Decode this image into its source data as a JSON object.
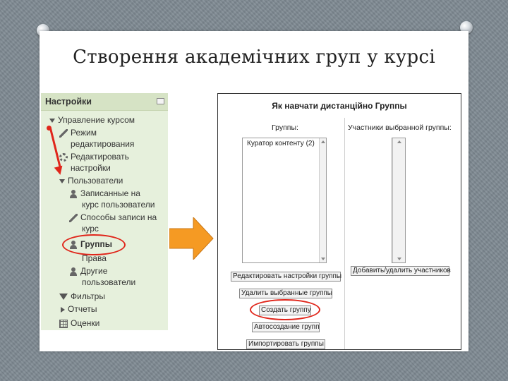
{
  "slide": {
    "title": "Створення академічних груп у курсі"
  },
  "settings_panel": {
    "header": "Настройки",
    "items": [
      {
        "label": "Управление курсом"
      },
      {
        "label": "Режим"
      },
      {
        "label": "редактирования"
      },
      {
        "label": "Редактировать"
      },
      {
        "label": "настройки"
      },
      {
        "label": "Пользователи"
      },
      {
        "label": "Записанные на"
      },
      {
        "label": "курс пользователи"
      },
      {
        "label": "Способы записи на"
      },
      {
        "label": "курс"
      },
      {
        "label": "Группы"
      },
      {
        "label": "Права"
      },
      {
        "label": "Другие"
      },
      {
        "label": "пользователи"
      },
      {
        "label": "Фильтры"
      },
      {
        "label": "Отчеты"
      },
      {
        "label": "Оценки"
      }
    ]
  },
  "groups_panel": {
    "title": "Як навчати дистанційно Группы",
    "groups_label": "Группы:",
    "members_label": "Участники выбранной группы:",
    "groups_list": [
      "Куратор контенту (2)"
    ],
    "buttons": {
      "edit_group_settings": "Редактировать настройки группы",
      "delete_selected_groups": "Удалить выбранные группы",
      "create_group": "Создать группу",
      "auto_create_groups": "Автосоздание групп",
      "import_groups": "Импортировать группы",
      "add_remove_members": "Добавить/удалить участников"
    }
  },
  "colors": {
    "highlight": "#e0261b",
    "arrow": "#f59a23",
    "panel_bg": "#e6f0dc"
  }
}
